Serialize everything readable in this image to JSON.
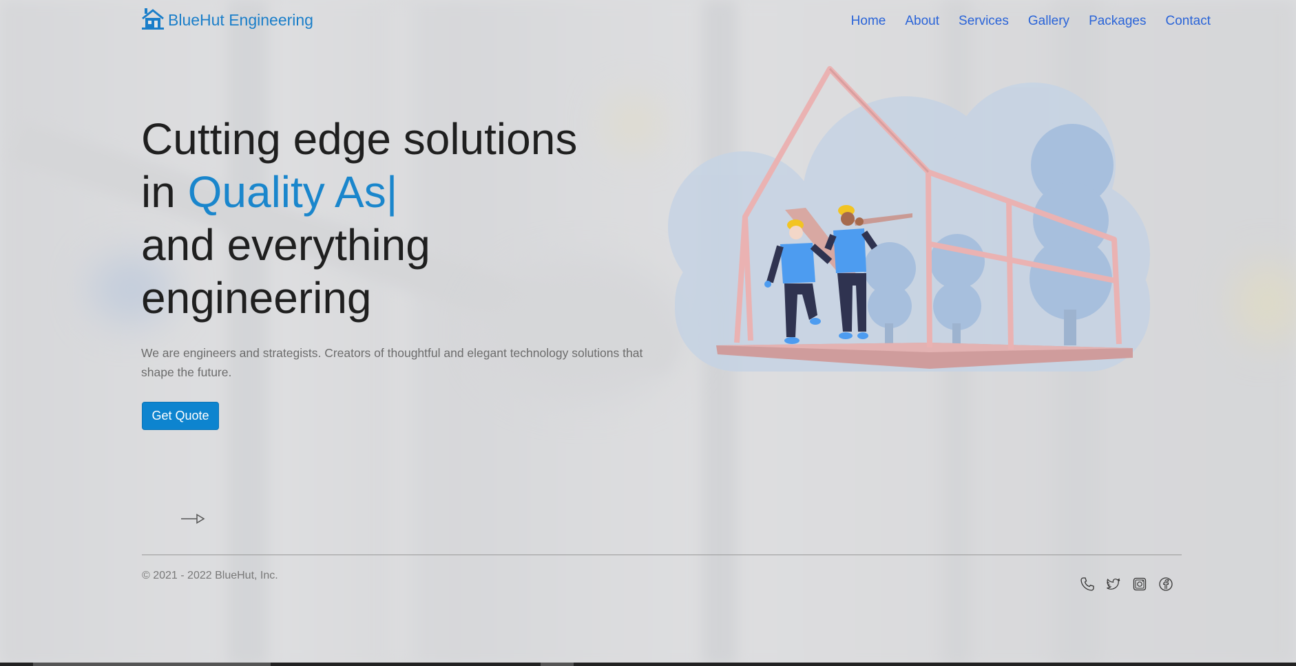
{
  "brand": {
    "name": "BlueHut Engineering",
    "logo_icon": "house-icon",
    "color": "#1a7ec9"
  },
  "nav": {
    "items": [
      {
        "label": "Home"
      },
      {
        "label": "About"
      },
      {
        "label": "Services"
      },
      {
        "label": "Gallery"
      },
      {
        "label": "Packages"
      },
      {
        "label": "Contact"
      }
    ]
  },
  "hero": {
    "line1": "Cutting edge solutions",
    "line2_prefix": "in ",
    "typed_text": "Quality As|",
    "line3": "and everything",
    "line4": "engineering",
    "description": "We are engineers and strategists. Creators of thoughtful and elegant technology solutions that shape the future.",
    "cta_label": "Get Quote",
    "accent_color": "#1a86cc",
    "illustration": "workers-building-house-frame"
  },
  "scroll_arrow_icon": "arrow-right-icon",
  "footer": {
    "copyright": "© 2021 - 2022 BlueHut, Inc.",
    "social_icons": [
      "phone-icon",
      "twitter-icon",
      "instagram-icon",
      "facebook-icon"
    ]
  }
}
